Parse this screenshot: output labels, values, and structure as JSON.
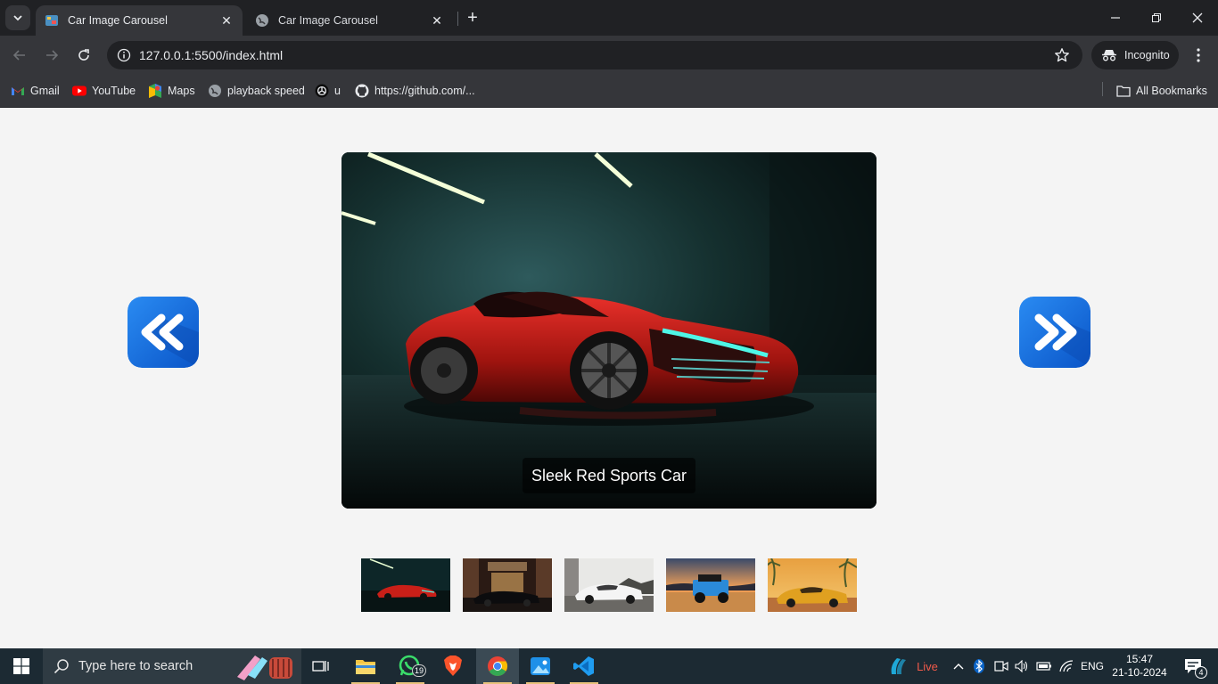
{
  "browser": {
    "tabs": [
      {
        "title": "Car Image Carousel",
        "active": true
      },
      {
        "title": "Car Image Carousel",
        "active": false
      }
    ],
    "address": "127.0.0.1:5500/index.html",
    "incognito_label": "Incognito",
    "bookmarks": [
      {
        "label": "Gmail",
        "icon": "gmail-icon"
      },
      {
        "label": "YouTube",
        "icon": "youtube-icon"
      },
      {
        "label": "Maps",
        "icon": "maps-icon"
      },
      {
        "label": "playback speed",
        "icon": "globe-icon"
      },
      {
        "label": "u",
        "icon": "openai-icon"
      },
      {
        "label": "https://github.com/...",
        "icon": "github-icon"
      }
    ],
    "all_bookmarks_label": "All Bookmarks"
  },
  "carousel": {
    "caption": "Sleek Red Sports Car",
    "current_index": 0,
    "thumbnails": [
      {
        "name": "red-sports-car",
        "scene": "dark garage"
      },
      {
        "name": "black-sedan",
        "scene": "hotel entrance"
      },
      {
        "name": "white-coupe",
        "scene": "mountain road"
      },
      {
        "name": "blue-jeep",
        "scene": "beach sunset"
      },
      {
        "name": "yellow-muscle-car",
        "scene": "tropical sunset"
      }
    ],
    "accent_color": "#1a73e8"
  },
  "taskbar": {
    "search_placeholder": "Type here to search",
    "whatsapp_badge": "19",
    "weather_label": "Live",
    "language": "ENG",
    "time": "15:47",
    "date": "21-10-2024",
    "notifications": "4"
  }
}
